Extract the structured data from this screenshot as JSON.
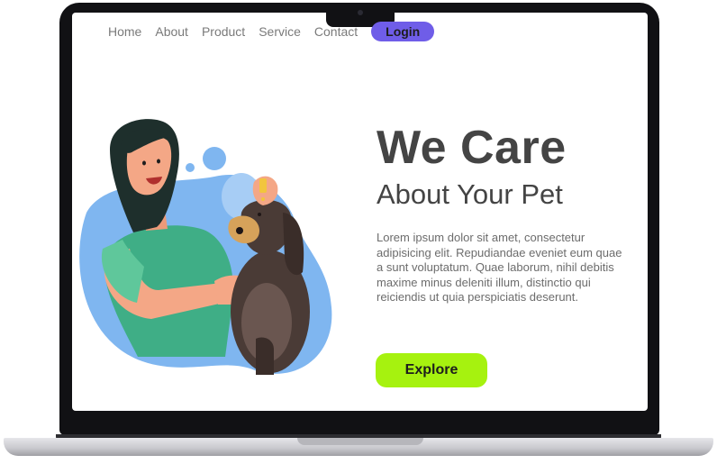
{
  "nav": {
    "links": [
      "Home",
      "About",
      "Product",
      "Service",
      "Contact"
    ],
    "login_label": "Login"
  },
  "hero": {
    "headline": "We Care",
    "subheadline": "About Your Pet",
    "body": "Lorem ipsum dolor sit amet, consectetur adipisicing elit. Repudiandae eveniet eum quae a sunt voluptatum. Quae laborum, nihil debitis maxime minus deleniti illum, distinctio qui reiciendis ut quia perspiciatis deserunt.",
    "cta_label": "Explore"
  },
  "colors": {
    "login_button": "#6f5de8",
    "cta_button": "#a6f20f",
    "blob": "#7fb6f0",
    "heading_text": "#444444"
  },
  "illustration": {
    "icon": "woman-grooming-dog-illustration"
  }
}
